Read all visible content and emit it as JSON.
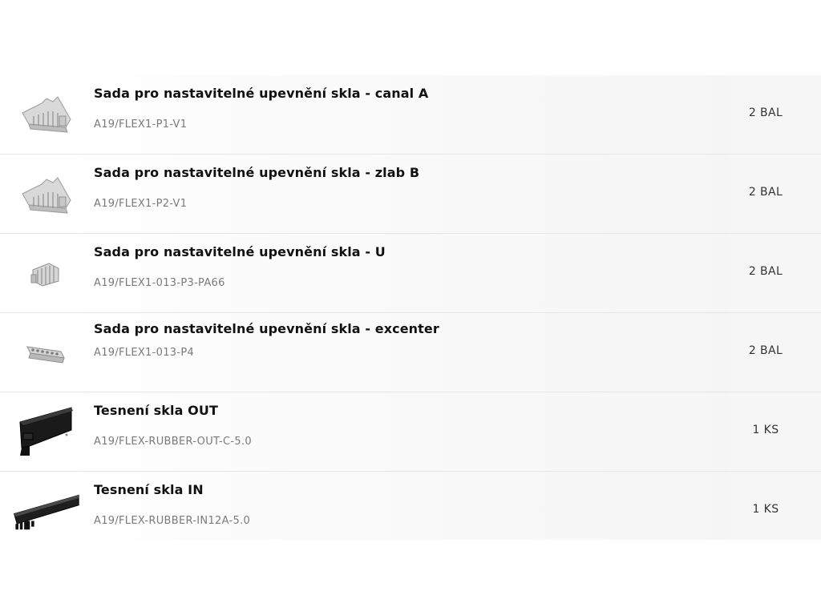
{
  "items": [
    {
      "name": "Sada pro nastavitelné upevnění skla - canal A",
      "code": "A19/FLEX1-P1-V1",
      "qty": "2 BAL",
      "icon": "gray-bracket-icon"
    },
    {
      "name": "Sada pro nastavitelné upevnění skla - zlab B",
      "code": "A19/FLEX1-P2-V1",
      "qty": "2 BAL",
      "icon": "gray-bracket-icon"
    },
    {
      "name": "Sada pro nastavitelné upevnění skla - U",
      "code": "A19/FLEX1-013-P3-PA66",
      "qty": "2 BAL",
      "icon": "gray-clip-icon"
    },
    {
      "name": "Sada pro nastavitelné upevnění skla - excenter",
      "code": "A19/FLEX1-013-P4",
      "qty": "2 BAL",
      "icon": "gray-eccentric-strip-icon"
    },
    {
      "name": "Tesnení skla OUT",
      "code": "A19/FLEX-RUBBER-OUT-C-5.0",
      "qty": "1 KS",
      "icon": "black-rubber-seal-out-icon"
    },
    {
      "name": "Tesnení skla IN",
      "code": "A19/FLEX-RUBBER-IN12A-5.0",
      "qty": "1 KS",
      "icon": "black-rubber-seal-in-icon"
    }
  ]
}
